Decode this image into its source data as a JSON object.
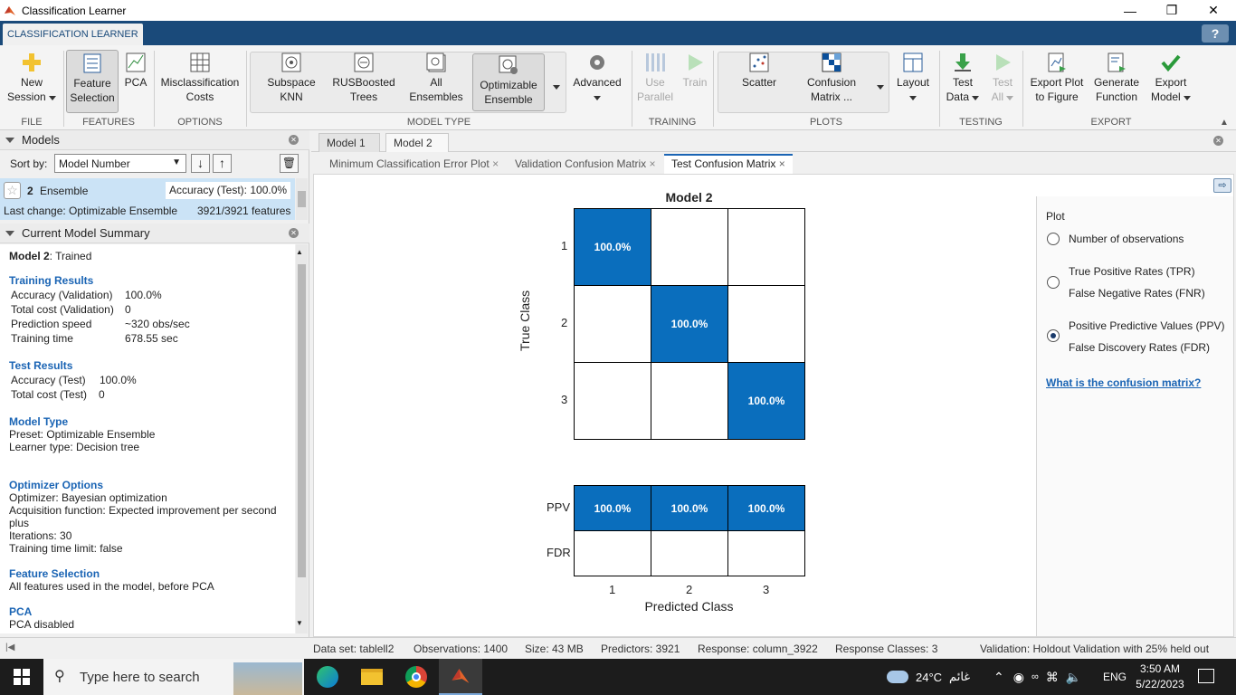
{
  "window": {
    "title": "Classification Learner"
  },
  "ribbon": {
    "tab": "CLASSIFICATION LEARNER",
    "help": "?"
  },
  "toolstrip": {
    "new_session": [
      "New",
      "Session"
    ],
    "feature_selection": [
      "Feature",
      "Selection"
    ],
    "pca": "PCA",
    "misclassification_costs": [
      "Misclassification",
      "Costs"
    ],
    "subspace_knn": [
      "Subspace",
      "KNN"
    ],
    "rusboosted_trees": [
      "RUSBoosted",
      "Trees"
    ],
    "all_ensembles": [
      "All",
      "Ensembles"
    ],
    "optimizable_ensemble": [
      "Optimizable",
      "Ensemble"
    ],
    "advanced": "Advanced",
    "use_parallel": [
      "Use",
      "Parallel"
    ],
    "train": "Train",
    "scatter": "Scatter",
    "confusion_matrix": [
      "Confusion",
      "Matrix"
    ],
    "confusion_ellipsis": "...",
    "layout": "Layout",
    "test_data": [
      "Test",
      "Data"
    ],
    "test_all": [
      "Test",
      "All"
    ],
    "export_plot": [
      "Export Plot",
      "to Figure"
    ],
    "generate_function": [
      "Generate",
      "Function"
    ],
    "export_model": [
      "Export",
      "Model"
    ],
    "groups": {
      "file": "FILE",
      "features": "FEATURES",
      "options": "OPTIONS",
      "model_type": "MODEL TYPE",
      "training": "TRAINING",
      "plots": "PLOTS",
      "testing": "TESTING",
      "export": "EXPORT"
    }
  },
  "models_panel": {
    "title": "Models",
    "sort_by_label": "Sort by:",
    "sort_by_value": "Model Number",
    "model": {
      "number": "2",
      "name": "Ensemble",
      "accuracy": "Accuracy (Test): 100.0%",
      "last_change": "Last change: Optimizable Ensemble",
      "features": "3921/3921 features"
    }
  },
  "summary_panel": {
    "title": "Current Model Summary",
    "model_status_bold": "Model 2",
    "model_status_rest": ": Trained",
    "training_results": {
      "heading": "Training Results",
      "rows": [
        {
          "label": "Accuracy (Validation)",
          "value": "100.0%"
        },
        {
          "label": "Total cost (Validation)",
          "value": "0"
        },
        {
          "label": "Prediction speed",
          "value": "~320 obs/sec"
        },
        {
          "label": "Training time",
          "value": "678.55 sec"
        }
      ]
    },
    "test_results": {
      "heading": "Test Results",
      "rows": [
        {
          "label": "Accuracy (Test)",
          "value": "100.0%"
        },
        {
          "label": "Total cost (Test)",
          "value": "0"
        }
      ]
    },
    "model_type": {
      "heading": "Model Type",
      "lines": [
        "Preset: Optimizable Ensemble",
        "Learner type: Decision tree"
      ]
    },
    "optimizer_options": {
      "heading": "Optimizer Options",
      "lines": [
        "Optimizer: Bayesian optimization",
        "Acquisition function: Expected improvement per second",
        "plus",
        "Iterations: 30",
        "Training time limit: false"
      ]
    },
    "feature_selection": {
      "heading": "Feature Selection",
      "lines": [
        "All features used in the model, before PCA"
      ]
    },
    "pca": {
      "heading": "PCA",
      "lines": [
        "PCA disabled"
      ]
    }
  },
  "doc_tabs": [
    "Model 1",
    "Model 2"
  ],
  "plot_tabs": [
    "Minimum Classification Error Plot",
    "Validation Confusion Matrix",
    "Test Confusion Matrix"
  ],
  "chart_data": {
    "type": "heatmap",
    "title": "Model 2",
    "xlabel": "Predicted Class",
    "ylabel": "True Class",
    "classes": [
      "1",
      "2",
      "3"
    ],
    "matrix": [
      [
        "100.0%",
        "",
        ""
      ],
      [
        "",
        "100.0%",
        ""
      ],
      [
        "",
        "",
        "100.0%"
      ]
    ],
    "summary_rows": [
      {
        "label": "PPV",
        "values": [
          "100.0%",
          "100.0%",
          "100.0%"
        ]
      },
      {
        "label": "FDR",
        "values": [
          "",
          "",
          ""
        ]
      }
    ],
    "highlight_color": "#0a6ebd"
  },
  "plot_panel": {
    "title": "Plot",
    "options": [
      {
        "lines": [
          "Number of observations"
        ],
        "selected": false
      },
      {
        "lines": [
          "True Positive Rates (TPR)",
          "False Negative Rates (FNR)"
        ],
        "selected": false
      },
      {
        "lines": [
          "Positive Predictive Values (PPV)",
          "False Discovery Rates (FDR)"
        ],
        "selected": true
      }
    ],
    "link": "What is the confusion matrix?"
  },
  "status": {
    "dataset": "Data set: tablell2",
    "observations": "Observations: 1400",
    "size": "Size: 43 MB",
    "predictors": "Predictors: 3921",
    "response": "Response: column_3922",
    "response_classes": "Response Classes: 3",
    "validation": "Validation: Holdout Validation with 25% held out"
  },
  "taskbar": {
    "search_placeholder": "Type here to search",
    "weather": "24°C",
    "weather_text": "غائم",
    "lang": "ENG",
    "time": "3:50 AM",
    "date": "5/22/2023"
  }
}
